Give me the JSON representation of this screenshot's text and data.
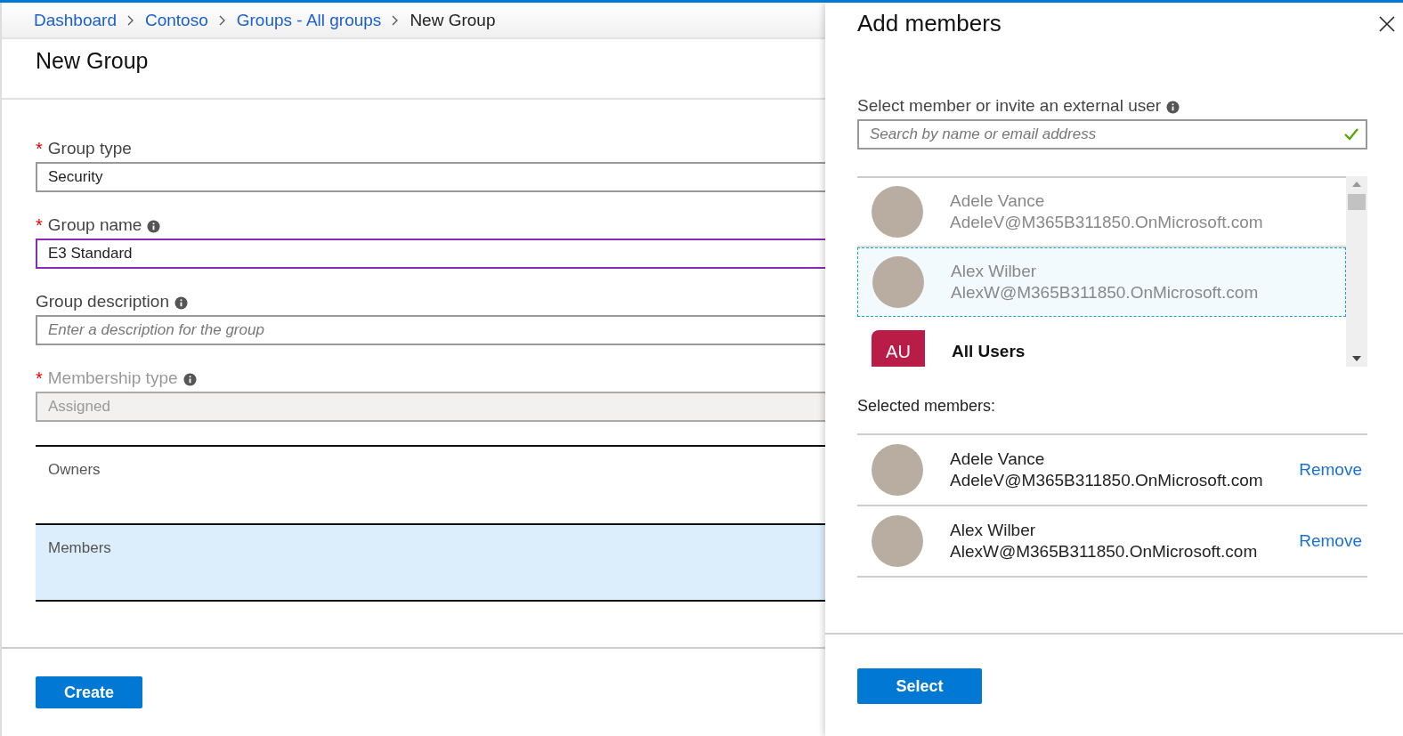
{
  "breadcrumb": [
    {
      "label": "Dashboard",
      "current": false
    },
    {
      "label": "Contoso",
      "current": false
    },
    {
      "label": "Groups - All groups",
      "current": false
    },
    {
      "label": "New Group",
      "current": true
    }
  ],
  "page_title": "New Group",
  "fields": [
    {
      "required_mark": "*",
      "label": "Group type",
      "value": "Security",
      "focused": false,
      "disabled": false
    },
    {
      "required_mark": "*",
      "label": "Group name",
      "info": true,
      "value": "E3 Standard",
      "focused": true,
      "disabled": false
    },
    {
      "label": "Group description",
      "info": true,
      "placeholder": "Enter a description for the group",
      "focused": false,
      "disabled": false
    },
    {
      "required_mark": "*",
      "label": "Membership type",
      "info": true,
      "value": "Assigned",
      "focused": false,
      "disabled": true
    }
  ],
  "sections": [
    {
      "label": "Owners",
      "selected": false
    },
    {
      "label": "Members",
      "selected": true
    }
  ],
  "create_button": "Create",
  "panel": {
    "title": "Add members",
    "search_label": "Select member or invite an external user",
    "search_placeholder": "Search by name or email address",
    "search_valid": true,
    "candidates": [
      {
        "kind": "person",
        "name": "Adele Vance",
        "email": "AdeleV@M365B311850.OnMicrosoft.com",
        "dimmed": true,
        "selected": false
      },
      {
        "kind": "person",
        "name": "Alex Wilber",
        "email": "AlexW@M365B311850.OnMicrosoft.com",
        "dimmed": true,
        "selected": true
      },
      {
        "kind": "group",
        "initials": "AU",
        "name": "All Users",
        "color": "#b91c47",
        "dimmed": false,
        "selected": false
      }
    ],
    "selected_label": "Selected members:",
    "selected_members": [
      {
        "name": "Adele Vance",
        "email": "AdeleV@M365B311850.OnMicrosoft.com",
        "action": "Remove"
      },
      {
        "name": "Alex Wilber",
        "email": "AlexW@M365B311850.OnMicrosoft.com",
        "action": "Remove"
      }
    ],
    "select_button": "Select"
  }
}
